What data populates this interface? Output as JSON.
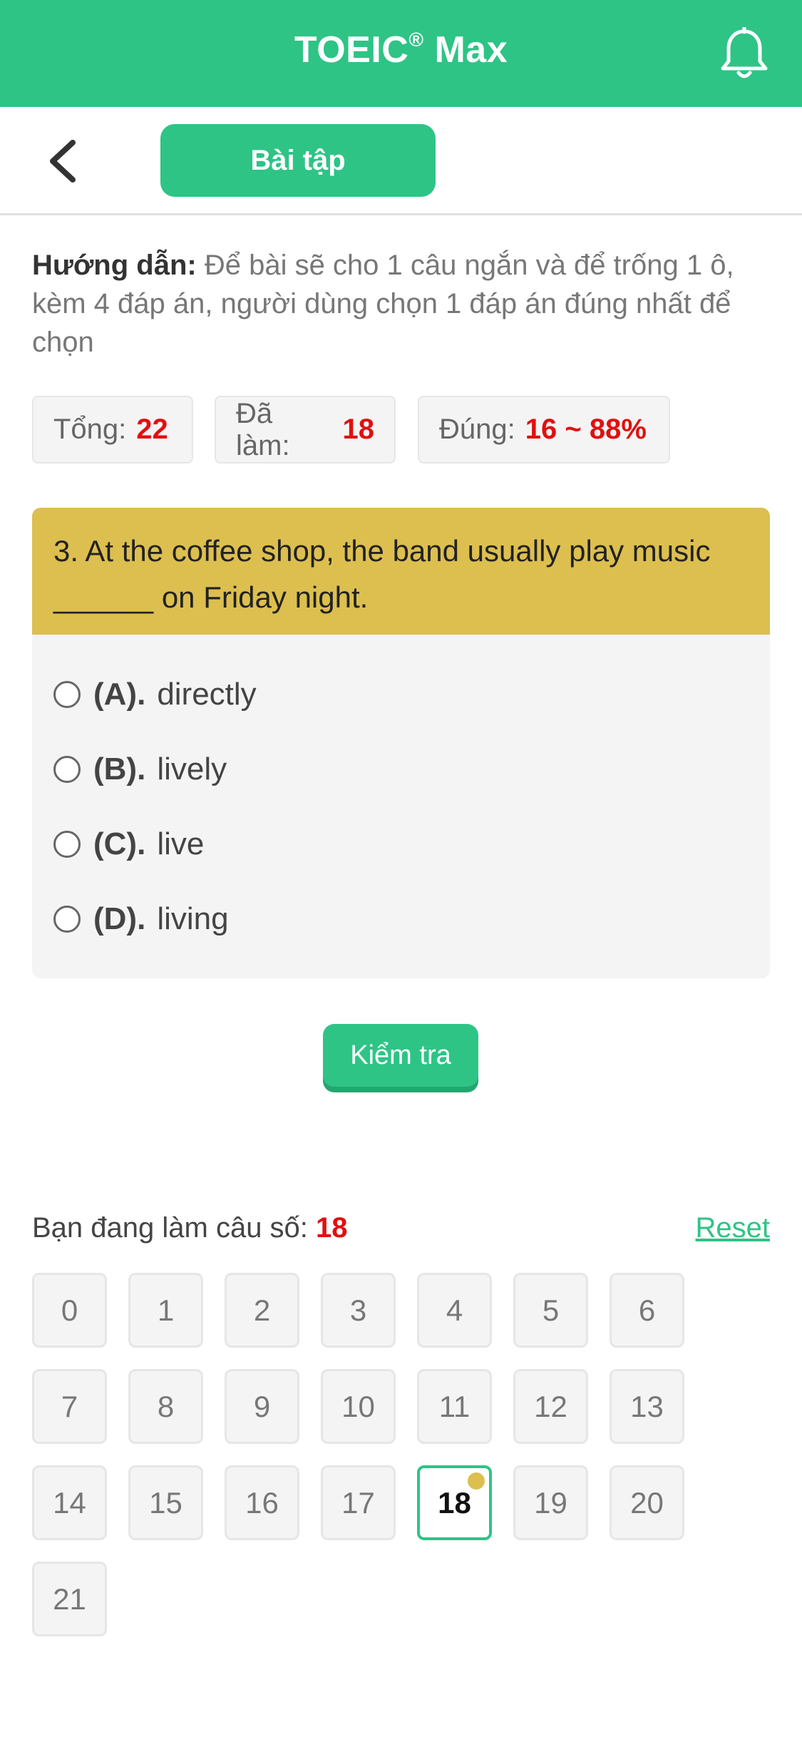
{
  "header": {
    "title": "TOEIC",
    "title_mark": "®",
    "title_suffix": "Max",
    "icons": {
      "notification": "bell-icon"
    },
    "colors": {
      "brand": "#2ec486"
    }
  },
  "subnav": {
    "back_icon": "chevron-left-icon",
    "tab_label": "Bài tập"
  },
  "guide": {
    "label": "Hướng dẫn:",
    "text": "Để bài sẽ cho 1 câu ngắn và để trống 1 ô, kèm 4 đáp án, người dùng chọn 1 đáp án đúng nhất để chọn"
  },
  "stats": {
    "total_label": "Tổng:",
    "total_value": "22",
    "done_label": "Đã làm:",
    "done_value": "18",
    "correct_label": "Đúng:",
    "correct_value": "16 ~ 88%"
  },
  "question": {
    "text": "3. At the coffee shop, the band usually play music ______ on Friday night.",
    "options": [
      {
        "label": "(A).",
        "text": "directly"
      },
      {
        "label": "(B).",
        "text": "lively"
      },
      {
        "label": "(C).",
        "text": "live"
      },
      {
        "label": "(D).",
        "text": "living"
      }
    ],
    "colors": {
      "header": "#dcbf4f"
    }
  },
  "check_button": "Kiểm tra",
  "navigator": {
    "current_label": "Bạn đang làm câu số:",
    "current_value": "18",
    "reset_label": "Reset",
    "cells": [
      "0",
      "1",
      "2",
      "3",
      "4",
      "5",
      "6",
      "7",
      "8",
      "9",
      "10",
      "11",
      "12",
      "13",
      "14",
      "15",
      "16",
      "17",
      "18",
      "19",
      "20",
      "21"
    ],
    "active": "18"
  }
}
